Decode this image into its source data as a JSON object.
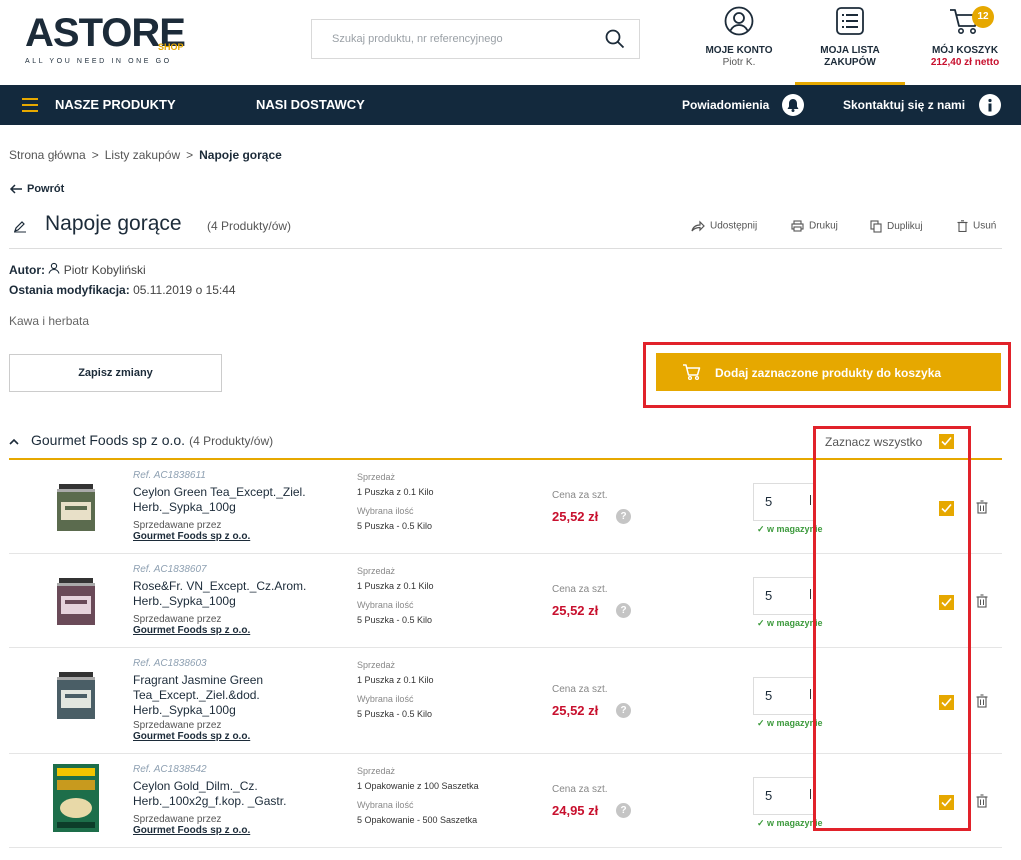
{
  "header": {
    "logo_text": "ASTORE",
    "logo_shop": "SHOP",
    "logo_tagline": "ALL YOU NEED IN ONE GO",
    "search_placeholder": "Szukaj produktu, nr referencyjnego",
    "account_label": "MOJE KONTO",
    "account_user": "Piotr K.",
    "lists_label_1": "MOJA LISTA",
    "lists_label_2": "ZAKUPÓW",
    "cart_label": "MÓJ KOSZYK",
    "cart_total": "212,40 zł netto",
    "cart_count": "12"
  },
  "nav": {
    "products": "NASZE PRODUKTY",
    "suppliers": "NASI DOSTAWCY",
    "notifications": "Powiadomienia",
    "contact": "Skontaktuj się z nami"
  },
  "breadcrumb": {
    "home": "Strona główna",
    "lists": "Listy zakupów",
    "current": "Napoje gorące"
  },
  "back_label": "Powrót",
  "list": {
    "title": "Napoje gorące",
    "count": "(4 Produkty/ów)",
    "actions": {
      "share": "Udostępnij",
      "print": "Drukuj",
      "duplicate": "Duplikuj",
      "delete": "Usuń"
    },
    "author_label": "Autor:",
    "author_name": "Piotr Kobyliński",
    "modified_label": "Ostania modyfikacja:",
    "modified_value": "05.11.2019 o 15:44",
    "description": "Kawa i herbata",
    "save_button": "Zapisz zmiany",
    "add_to_cart_button": "Dodaj zaznaczone produkty do koszyka"
  },
  "supplier": {
    "name": "Gourmet Foods sp z o.o.",
    "count": "(4 Produkty/ów)",
    "select_all": "Zaznacz wszystko",
    "select_all_checked": true
  },
  "labels": {
    "sold_as": "Sprzedaż",
    "chosen_qty": "Wybrana ilość",
    "sold_by": "Sprzedawane przez",
    "unit_price": "Cena za szt.",
    "in_stock": "w magazynie",
    "help": "?"
  },
  "colors": {
    "accent": "#e6a800",
    "navy": "#13293d",
    "price": "#c8102e",
    "stock": "#3c9a3c",
    "highlight": "#e1222a"
  },
  "products": [
    {
      "ref": "Ref. AC1838611",
      "name": "Ceylon Green Tea_Except._Ziel. Herb._Sypka_100g",
      "seller": "Gourmet Foods sp z o.o.",
      "sold_as": "1 Puszka z 0.1 Kilo",
      "chosen": "5 Puszka - 0.5 Kilo",
      "price": "25,52 zł",
      "qty": "5",
      "checked": true
    },
    {
      "ref": "Ref. AC1838607",
      "name": "Rose&Fr. VN_Except._Cz.Arom. Herb._Sypka_100g",
      "seller": "Gourmet Foods sp z o.o.",
      "sold_as": "1 Puszka z 0.1 Kilo",
      "chosen": "5 Puszka - 0.5 Kilo",
      "price": "25,52 zł",
      "qty": "5",
      "checked": true
    },
    {
      "ref": "Ref. AC1838603",
      "name": "Fragrant Jasmine Green Tea_Except._Ziel.&dod. Herb._Sypka_100g",
      "seller": "Gourmet Foods sp z o.o.",
      "sold_as": "1 Puszka z 0.1 Kilo",
      "chosen": "5 Puszka - 0.5 Kilo",
      "price": "25,52 zł",
      "qty": "5",
      "checked": true
    },
    {
      "ref": "Ref. AC1838542",
      "name": "Ceylon Gold_Dilm._Cz. Herb._100x2g_f.kop. _Gastr.",
      "seller": "Gourmet Foods sp z o.o.",
      "sold_as": "1 Opakowanie z 100 Saszetka",
      "chosen": "5 Opakowanie - 500 Saszetka",
      "price": "24,95 zł",
      "qty": "5",
      "checked": true
    }
  ]
}
